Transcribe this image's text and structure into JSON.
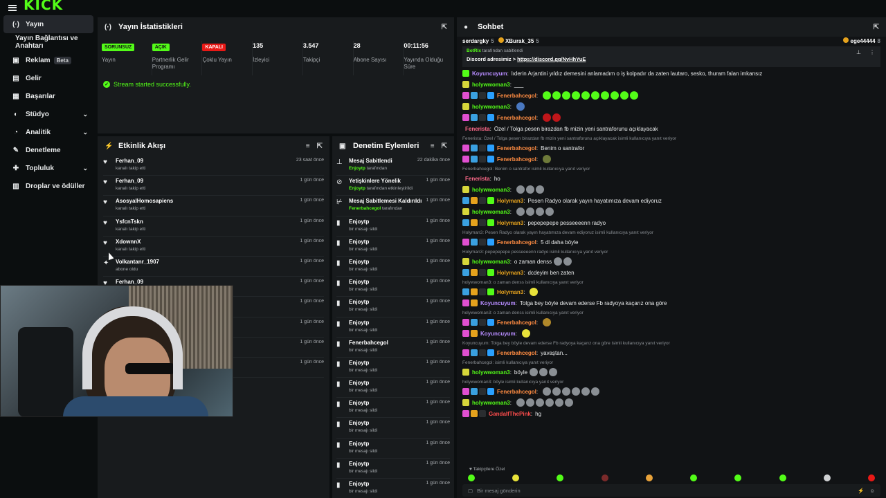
{
  "app": {
    "logo": "KICK"
  },
  "sidebar": {
    "items": [
      {
        "label": "Yayın",
        "icon": "broadcast-icon",
        "glyph": "(·)"
      },
      {
        "label": "Yayın Bağlantısı ve Anahtarı",
        "icon": "",
        "glyph": ""
      },
      {
        "label": "Reklam",
        "icon": "ad-icon",
        "glyph": "▣",
        "badge": "Beta"
      },
      {
        "label": "Gelir",
        "icon": "revenue-icon",
        "glyph": "▤"
      },
      {
        "label": "Başarılar",
        "icon": "achievements-icon",
        "glyph": "▦"
      },
      {
        "label": "Stüdyo",
        "icon": "studio-icon",
        "glyph": "◐"
      },
      {
        "label": "Analitik",
        "icon": "analytics-icon",
        "glyph": "◔"
      },
      {
        "label": "Denetleme",
        "icon": "wrench-icon",
        "glyph": "✎"
      },
      {
        "label": "Topluluk",
        "icon": "community-icon",
        "glyph": "✚"
      },
      {
        "label": "Droplar ve ödüller",
        "icon": "gift-icon",
        "glyph": "▥"
      }
    ]
  },
  "stats": {
    "title": "Yayın İstatistikleri",
    "items": [
      {
        "badge": "SORUNSUZ",
        "label": "Yayın"
      },
      {
        "badge": "AÇIK",
        "label": "Partnerlik Gelir Programı"
      },
      {
        "badge": "KAPALI",
        "label": "Çoklu Yayın"
      },
      {
        "value": "135",
        "label": "İzleyici"
      },
      {
        "value": "3.547",
        "label": "Takipçi"
      },
      {
        "value": "28",
        "label": "Abone Sayısı"
      },
      {
        "value": "00:11:56",
        "label": "Yayında Olduğu Süre"
      }
    ],
    "success": "Stream started successfully."
  },
  "activity": {
    "title": "Etkinlik Akışı",
    "rows": [
      {
        "name": "Ferhan_09",
        "sub": "kanalı takip etti",
        "time": "23 saat önce",
        "icon": "heart-icon",
        "glyph": "♥"
      },
      {
        "name": "Ferhan_09",
        "sub": "kanalı takip etti",
        "time": "1 gün önce",
        "icon": "heart-icon",
        "glyph": "♥"
      },
      {
        "name": "AsosyalHomosapiens",
        "sub": "kanalı takip etti",
        "time": "1 gün önce",
        "icon": "heart-icon",
        "glyph": "♥"
      },
      {
        "name": "YsfcnTskn",
        "sub": "kanalı takip etti",
        "time": "1 gün önce",
        "icon": "heart-icon",
        "glyph": "♥"
      },
      {
        "name": "XdownnX",
        "sub": "kanalı takip etti",
        "time": "1 gün önce",
        "icon": "heart-icon",
        "glyph": "♥"
      },
      {
        "name": "Volkantanr_1907",
        "sub": "abone oldu",
        "time": "1 gün önce",
        "icon": "star-icon",
        "glyph": "✦"
      },
      {
        "name": "Ferhan_09",
        "sub": "",
        "time": "1 gün önce",
        "icon": "heart-icon",
        "glyph": "♥"
      },
      {
        "name": "",
        "sub": "",
        "time": "1 gün önce",
        "icon": "",
        "glyph": ""
      },
      {
        "name": "",
        "sub": "",
        "time": "1 gün önce",
        "icon": "",
        "glyph": ""
      },
      {
        "name": "",
        "sub": "",
        "time": "1 gün önce",
        "icon": "",
        "glyph": ""
      },
      {
        "name": "",
        "sub": "",
        "time": "1 gün önce",
        "icon": "",
        "glyph": ""
      }
    ]
  },
  "moderation": {
    "title": "Denetim Eylemleri",
    "rows": [
      {
        "name": "Mesaj Sabitlendi",
        "by": "Enjoytp",
        "sub": "tarafından",
        "time": "22 dakika önce",
        "icon": "pin-icon",
        "glyph": "⊥"
      },
      {
        "name": "Yetişkinlere Yönelik",
        "by": "Enjoytp",
        "sub": "tarafından etkinleştirildi",
        "time": "1 gün önce",
        "icon": "eye-off-icon",
        "glyph": "⊘"
      },
      {
        "name": "Mesaj Sabitlemesi Kaldırıldı",
        "by": "Fenerbahcegol",
        "sub": "tarafından",
        "time": "1 gün önce",
        "icon": "unpin-icon",
        "glyph": "⊬"
      },
      {
        "name": "Enjoytp",
        "by": "",
        "sub": "bir mesajı sildi",
        "time": "1 gün önce",
        "icon": "trash-icon",
        "glyph": "▮"
      },
      {
        "name": "Enjoytp",
        "by": "",
        "sub": "bir mesajı sildi",
        "time": "1 gün önce",
        "icon": "trash-icon",
        "glyph": "▮"
      },
      {
        "name": "Enjoytp",
        "by": "",
        "sub": "bir mesajı sildi",
        "time": "1 gün önce",
        "icon": "trash-icon",
        "glyph": "▮"
      },
      {
        "name": "Enjoytp",
        "by": "",
        "sub": "bir mesajı sildi",
        "time": "1 gün önce",
        "icon": "trash-icon",
        "glyph": "▮"
      },
      {
        "name": "Enjoytp",
        "by": "",
        "sub": "bir mesajı sildi",
        "time": "1 gün önce",
        "icon": "trash-icon",
        "glyph": "▮"
      },
      {
        "name": "Enjoytp",
        "by": "",
        "sub": "bir mesajı sildi",
        "time": "1 gün önce",
        "icon": "trash-icon",
        "glyph": "▮"
      },
      {
        "name": "Fenerbahcegol",
        "by": "",
        "sub": "bir mesajı sildi",
        "time": "1 gün önce",
        "icon": "trash-icon",
        "glyph": "▮"
      },
      {
        "name": "Enjoytp",
        "by": "",
        "sub": "bir mesajı sildi",
        "time": "1 gün önce",
        "icon": "trash-icon",
        "glyph": "▮"
      },
      {
        "name": "Enjoytp",
        "by": "",
        "sub": "bir mesajı sildi",
        "time": "1 gün önce",
        "icon": "trash-icon",
        "glyph": "▮"
      },
      {
        "name": "Enjoytp",
        "by": "",
        "sub": "bir mesajı sildi",
        "time": "1 gün önce",
        "icon": "trash-icon",
        "glyph": "▮"
      },
      {
        "name": "Enjoytp",
        "by": "",
        "sub": "bir mesajı sildi",
        "time": "1 gün önce",
        "icon": "trash-icon",
        "glyph": "▮"
      },
      {
        "name": "Enjoytp",
        "by": "",
        "sub": "bir mesajı sildi",
        "time": "1 gün önce",
        "icon": "trash-icon",
        "glyph": "▮"
      },
      {
        "name": "Enjoytp",
        "by": "",
        "sub": "bir mesajı sildi",
        "time": "1 gün önce",
        "icon": "trash-icon",
        "glyph": "▮"
      },
      {
        "name": "Enjoytp",
        "by": "",
        "sub": "bir mesajı sildi",
        "time": "1 gün önce",
        "icon": "trash-icon",
        "glyph": "▮"
      }
    ]
  },
  "chat": {
    "title": "Sohbet",
    "top_users": [
      {
        "name": "serdargky",
        "count": "5"
      },
      {
        "name": "XBurak_35",
        "count": "5"
      },
      {
        "name": "ege44444",
        "count": "8"
      }
    ],
    "pinned": {
      "by": "BotRix",
      "by_suffix": "tarafından sabitlendi",
      "text": "Discord adresimiz > ",
      "link": "https://discord.gg/NvHhYuE"
    },
    "messages": [
      {
        "type": "msg",
        "user": "Koyuncuyum",
        "color": "#b78cff",
        "text": "lıderin Arjantini yıldız demesini anlamadım o iş kolpadır da zaten lautaro, sesko, thuram falan imkansız",
        "badges": [
          "#53fc18"
        ]
      },
      {
        "type": "msg",
        "user": "holywwoman3",
        "color": "#53fc18",
        "text": "___",
        "badges": [
          "#d6d63a"
        ]
      },
      {
        "type": "msg",
        "user": "Fenerbahcegol",
        "color": "#ff8c42",
        "text": "",
        "badges": [
          "#e04fd0",
          "#3aa0e0",
          "#2a2d30",
          "#2aa0ff"
        ],
        "emotes": 10,
        "emote_color": "#53fc18"
      },
      {
        "type": "msg",
        "user": "holywwoman3",
        "color": "#53fc18",
        "text": "",
        "badges": [
          "#d6d63a"
        ],
        "emotes": 1,
        "emote_color": "#4a78c0"
      },
      {
        "type": "msg",
        "user": "Fenerbahcegol",
        "color": "#ff8c42",
        "text": "",
        "badges": [
          "#e04fd0",
          "#3aa0e0",
          "#2a2d30",
          "#2aa0ff"
        ],
        "emotes": 2,
        "emote_color": "#c0161a"
      },
      {
        "type": "msg",
        "user": "Fenerista",
        "color": "#ff6a8a",
        "text": "Özel / Tolga pesen birazdan fb mizin yeni santraforunu açıklayacak",
        "badges": []
      },
      {
        "type": "reply",
        "text": "Fenerista: Özel / Tolga pesen birazdan fb mizin yeni santraforunu açıklayacak isimli kullanıcıya yanıt veriyor"
      },
      {
        "type": "msg",
        "user": "Fenerbahcegol",
        "color": "#ff8c42",
        "text": "Benim o santrafor",
        "badges": [
          "#e04fd0",
          "#3aa0e0",
          "#2a2d30",
          "#2aa0ff"
        ]
      },
      {
        "type": "msg",
        "user": "Fenerbahcegol",
        "color": "#ff8c42",
        "text": "",
        "badges": [
          "#e04fd0",
          "#3aa0e0",
          "#2a2d30",
          "#2aa0ff"
        ],
        "emotes": 1,
        "emote_color": "#6e7a3a"
      },
      {
        "type": "reply",
        "text": "Fenerbahcegol: Benim o santrafor isimli kullanıcıya yanıt veriyor"
      },
      {
        "type": "msg",
        "user": "Fenerista",
        "color": "#ff6a8a",
        "text": "ho",
        "badges": []
      },
      {
        "type": "msg",
        "user": "holywwoman3",
        "color": "#53fc18",
        "text": "",
        "badges": [
          "#d6d63a"
        ],
        "emotes": 3,
        "emote_color": "#8a8f94"
      },
      {
        "type": "msg",
        "user": "Holyman3",
        "color": "#e5a21d",
        "text": "Pesen Radyo olarak yayın hayatımıza devam ediyoruz",
        "badges": [
          "#3aa0e0",
          "#e5a21d",
          "#2a2d30",
          "#53fc18"
        ]
      },
      {
        "type": "msg",
        "user": "holywwoman3",
        "color": "#53fc18",
        "text": "",
        "badges": [
          "#d6d63a"
        ],
        "emotes": 4,
        "emote_color": "#8a8f94"
      },
      {
        "type": "msg",
        "user": "Holyman3",
        "color": "#e5a21d",
        "text": "pepepepepe pesseeeenn radyo",
        "badges": [
          "#3aa0e0",
          "#e5a21d",
          "#2a2d30",
          "#53fc18"
        ]
      },
      {
        "type": "reply",
        "text": "Holyman3: Pesen Radyo olarak yayın hayatımıza devam ediyoruz isimli kullanıcıya yanıt veriyor"
      },
      {
        "type": "msg",
        "user": "Fenerbahcegol",
        "color": "#ff8c42",
        "text": "5 dl daha böyle",
        "badges": [
          "#e04fd0",
          "#3aa0e0",
          "#2a2d30",
          "#2aa0ff"
        ]
      },
      {
        "type": "reply",
        "text": "Holyman3: pepepepepe pesseeeenn radyo isimli kullanıcıya yanıt veriyor"
      },
      {
        "type": "msg",
        "user": "holywwoman3",
        "color": "#53fc18",
        "text": "o zaman denss",
        "badges": [
          "#d6d63a"
        ],
        "emotes": 2,
        "emote_color": "#8a8f94"
      },
      {
        "type": "msg",
        "user": "Holyman3",
        "color": "#e5a21d",
        "text": "dcdeyim ben zaten",
        "badges": [
          "#3aa0e0",
          "#e5a21d",
          "#2a2d30",
          "#53fc18"
        ]
      },
      {
        "type": "reply",
        "text": "holywwoman3: o zaman denss isimli kullanıcıya yanıt veriyor"
      },
      {
        "type": "msg",
        "user": "Holyman3",
        "color": "#e5a21d",
        "text": "",
        "badges": [
          "#3aa0e0",
          "#e5a21d",
          "#2a2d30",
          "#53fc18"
        ],
        "emotes": 1,
        "emote_color": "#e8e23a"
      },
      {
        "type": "msg",
        "user": "Koyuncuyum",
        "color": "#b78cff",
        "text": "Tolga bey böyle devam ederse Fb radyoya kaçarız ona göre",
        "badges": [
          "#e04fd0",
          "#e5a21d"
        ]
      },
      {
        "type": "reply",
        "text": "holywwoman3: o zaman denss isimli kullanıcıya yanıt veriyor"
      },
      {
        "type": "msg",
        "user": "Fenerbahcegol",
        "color": "#ff8c42",
        "text": "",
        "badges": [
          "#e04fd0",
          "#3aa0e0",
          "#2a2d30",
          "#2aa0ff"
        ],
        "emotes": 1,
        "emote_color": "#b0882a"
      },
      {
        "type": "msg",
        "user": "Koyuncuyum",
        "color": "#b78cff",
        "text": "",
        "badges": [
          "#e04fd0",
          "#e5a21d"
        ],
        "emotes": 1,
        "emote_color": "#e8e23a"
      },
      {
        "type": "reply",
        "text": "Koyuncuyum: Tolga bey böyle devam ederse Fb radyoya kaçarız ona göre isimli kullanıcıya yanıt veriyor"
      },
      {
        "type": "msg",
        "user": "Fenerbahcegol",
        "color": "#ff8c42",
        "text": "yavaştan...",
        "badges": [
          "#e04fd0",
          "#3aa0e0",
          "#2a2d30",
          "#2aa0ff"
        ]
      },
      {
        "type": "reply",
        "text": "Fenerbahcegol: isimli kullanıcıya yanıt veriyor"
      },
      {
        "type": "msg",
        "user": "holywwoman3",
        "color": "#53fc18",
        "text": "böyle",
        "badges": [
          "#d6d63a"
        ],
        "emotes": 3,
        "emote_color": "#8a8f94"
      },
      {
        "type": "reply",
        "text": "holywwoman3: böyle isimli kullanıcıya yanıt veriyor"
      },
      {
        "type": "msg",
        "user": "Fenerbahcegol",
        "color": "#ff8c42",
        "text": "",
        "badges": [
          "#e04fd0",
          "#3aa0e0",
          "#2a2d30",
          "#2aa0ff"
        ],
        "emotes": 6,
        "emote_color": "#8a8f94"
      },
      {
        "type": "msg",
        "user": "holywwoman3",
        "color": "#53fc18",
        "text": "",
        "badges": [
          "#d6d63a"
        ],
        "emotes": 6,
        "emote_color": "#8a8f94"
      },
      {
        "type": "msg",
        "user": "GandalfThePink",
        "color": "#ff4d4d",
        "text": "hg",
        "badges": [
          "#e04fd0",
          "#e5a21d",
          "#2a2d30"
        ]
      }
    ],
    "followers_only": "Takipçilere Özel",
    "emote_bar": [
      "#53fc18",
      "#e8e23a",
      "#53fc18",
      "#7a2a2a",
      "#e8a23a",
      "#53fc18",
      "#53fc18",
      "#53fc18",
      "#cfd1d3",
      "#e91916"
    ],
    "input_placeholder": "Bir mesaj gönderin"
  },
  "colors": {
    "brand": "#53fc18",
    "panel": "#181b1d",
    "bg": "#0b0e0f"
  }
}
